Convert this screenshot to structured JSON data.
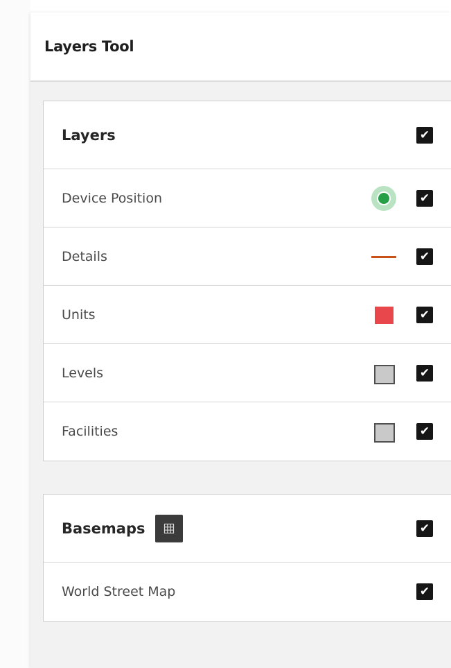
{
  "panel": {
    "title": "Layers Tool"
  },
  "layers": {
    "heading": "Layers",
    "all_checked": true,
    "items": [
      {
        "label": "Device Position",
        "legend": "green-point",
        "checked": true
      },
      {
        "label": "Details",
        "legend": "orange-line",
        "checked": true
      },
      {
        "label": "Units",
        "legend": "red-fill",
        "checked": true
      },
      {
        "label": "Levels",
        "legend": "gray-fill",
        "checked": true
      },
      {
        "label": "Facilities",
        "legend": "gray-fill",
        "checked": true
      }
    ]
  },
  "basemaps": {
    "heading": "Basemaps",
    "gallery_icon": "grid-icon",
    "all_checked": true,
    "items": [
      {
        "label": "World Street Map",
        "checked": true
      }
    ]
  },
  "icons": {
    "checkmark": "✔"
  },
  "colors": {
    "checkbox": "#161616",
    "device_position": "#25a046",
    "details_line": "#c9521a",
    "units_fill": "#e8474c",
    "levels_fill": "#c9c9c9"
  }
}
